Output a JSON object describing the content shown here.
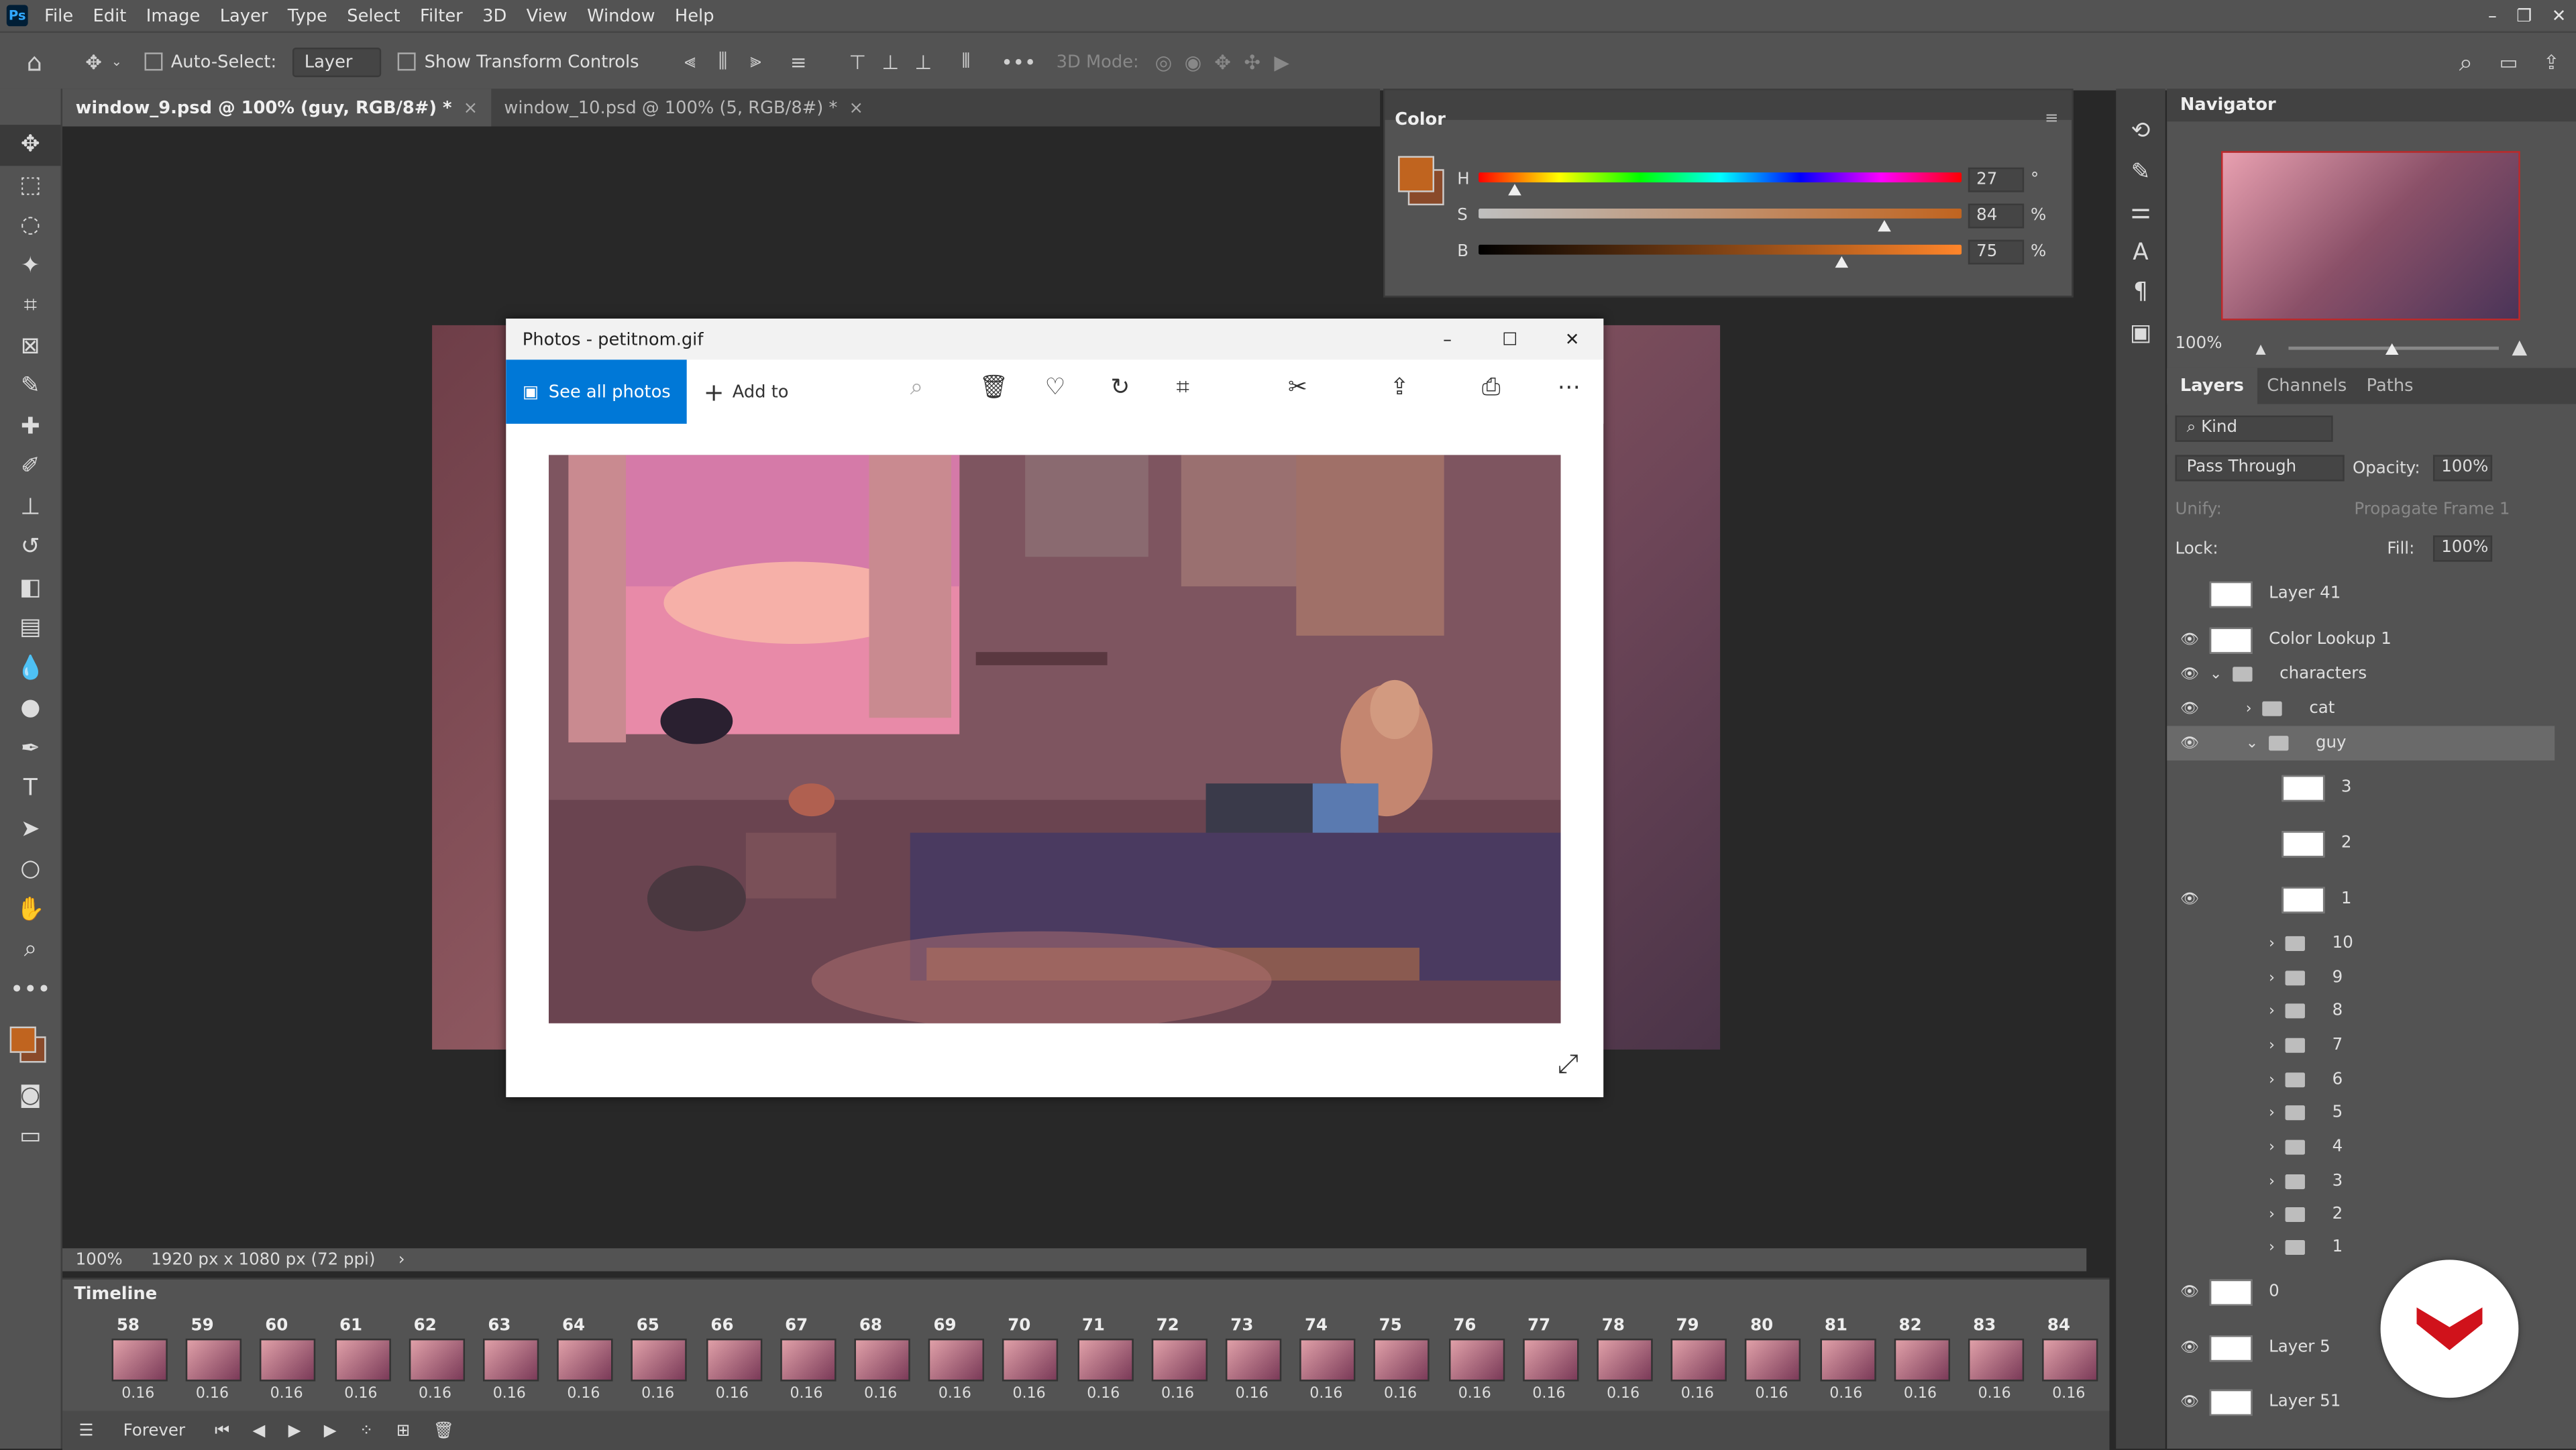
{
  "app": {
    "logo": "Ps"
  },
  "menu": [
    "File",
    "Edit",
    "Image",
    "Layer",
    "Type",
    "Select",
    "Filter",
    "3D",
    "View",
    "Window",
    "Help"
  ],
  "options": {
    "auto_select_label": "Auto-Select:",
    "auto_select_value": "Layer",
    "show_transform_label": "Show Transform Controls",
    "mode_3d_label": "3D Mode:"
  },
  "tabs": [
    {
      "label": "window_9.psd @ 100% (guy, RGB/8#) *",
      "close": "×"
    },
    {
      "label": "window_10.psd @ 100% (5, RGB/8#) *",
      "close": "×"
    }
  ],
  "status": {
    "zoom": "100%",
    "doc_info": "1920 px x 1080 px (72 ppi)",
    "arrow": "›"
  },
  "photos": {
    "title": "Photos - petitnom.gif",
    "see_all": "See all photos",
    "add_to": "Add to",
    "minimize": "–",
    "maximize": "☐",
    "close": "✕"
  },
  "color_panel": {
    "title": "Color",
    "h_label": "H",
    "h_value": "27",
    "h_unit": "°",
    "h_frac": 0.075,
    "s_label": "S",
    "s_value": "84",
    "s_unit": "%",
    "s_frac": 0.84,
    "b_label": "B",
    "b_value": "75",
    "b_unit": "%",
    "b_frac": 0.75,
    "fg_color": "#c0641f",
    "bg_color": "#8a4a2a"
  },
  "navigator": {
    "title": "Navigator",
    "zoom": "100%"
  },
  "layers_panel": {
    "tabs": [
      "Layers",
      "Channels",
      "Paths"
    ],
    "kind": "Kind",
    "blend_mode": "Pass Through",
    "opacity_label": "Opacity:",
    "opacity": "100%",
    "unify_label": "Unify:",
    "propagate": "Propagate Frame 1",
    "lock_label": "Lock:",
    "fill_label": "Fill:",
    "fill": "100%",
    "layers": [
      {
        "name": "Layer 41",
        "visible": false,
        "type": "layer"
      },
      {
        "name": "Color Lookup 1",
        "visible": true,
        "type": "adjust"
      },
      {
        "name": "characters",
        "visible": true,
        "type": "group-open"
      },
      {
        "name": "cat",
        "visible": true,
        "type": "group"
      },
      {
        "name": "guy",
        "visible": true,
        "type": "group-open"
      },
      {
        "name": "3",
        "visible": false,
        "type": "layer"
      },
      {
        "name": "2",
        "visible": false,
        "type": "layer"
      },
      {
        "name": "1",
        "visible": true,
        "type": "layer"
      },
      {
        "name": "10",
        "visible": false,
        "type": "group"
      },
      {
        "name": "9",
        "visible": false,
        "type": "group"
      },
      {
        "name": "8",
        "visible": false,
        "type": "group"
      },
      {
        "name": "7",
        "visible": false,
        "type": "group"
      },
      {
        "name": "6",
        "visible": false,
        "type": "group"
      },
      {
        "name": "5",
        "visible": false,
        "type": "group"
      },
      {
        "name": "4",
        "visible": false,
        "type": "group"
      },
      {
        "name": "3",
        "visible": false,
        "type": "group"
      },
      {
        "name": "2",
        "visible": false,
        "type": "group"
      },
      {
        "name": "1",
        "visible": false,
        "type": "group"
      },
      {
        "name": "0",
        "visible": true,
        "type": "layer"
      },
      {
        "name": "Layer 5",
        "visible": true,
        "type": "layer"
      },
      {
        "name": "Layer 51",
        "visible": true,
        "type": "layer"
      }
    ]
  },
  "timeline": {
    "title": "Timeline",
    "loop": "Forever",
    "frames": [
      {
        "n": "58",
        "t": "0.16"
      },
      {
        "n": "59",
        "t": "0.16"
      },
      {
        "n": "60",
        "t": "0.16"
      },
      {
        "n": "61",
        "t": "0.16"
      },
      {
        "n": "62",
        "t": "0.16"
      },
      {
        "n": "63",
        "t": "0.16"
      },
      {
        "n": "64",
        "t": "0.16"
      },
      {
        "n": "65",
        "t": "0.16"
      },
      {
        "n": "66",
        "t": "0.16"
      },
      {
        "n": "67",
        "t": "0.16"
      },
      {
        "n": "68",
        "t": "0.16"
      },
      {
        "n": "69",
        "t": "0.16"
      },
      {
        "n": "70",
        "t": "0.16"
      },
      {
        "n": "71",
        "t": "0.16"
      },
      {
        "n": "72",
        "t": "0.16"
      },
      {
        "n": "73",
        "t": "0.16"
      },
      {
        "n": "74",
        "t": "0.16"
      },
      {
        "n": "75",
        "t": "0.16"
      },
      {
        "n": "76",
        "t": "0.16"
      },
      {
        "n": "77",
        "t": "0.16"
      },
      {
        "n": "78",
        "t": "0.16"
      },
      {
        "n": "79",
        "t": "0.16"
      },
      {
        "n": "80",
        "t": "0.16"
      },
      {
        "n": "81",
        "t": "0.16"
      },
      {
        "n": "82",
        "t": "0.16"
      },
      {
        "n": "83",
        "t": "0.16"
      },
      {
        "n": "84",
        "t": "0.16"
      }
    ]
  }
}
